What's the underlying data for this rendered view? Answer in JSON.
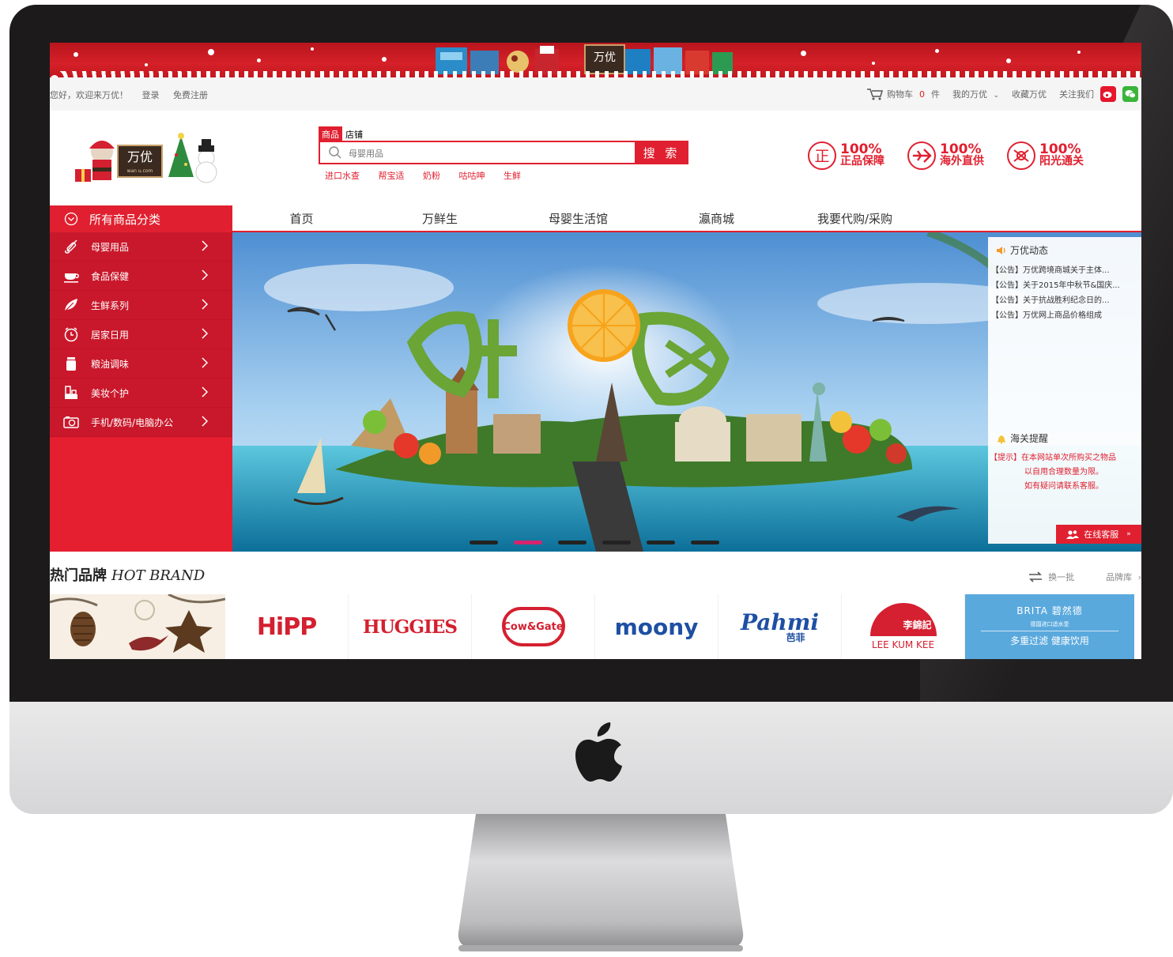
{
  "topbar": {
    "greeting": "您好，欢迎来万优！",
    "login": "登录",
    "register": "免费注册",
    "cart_label": "购物车",
    "cart_count": "0",
    "cart_unit": "件",
    "my_account": "我的万优",
    "favorite": "收藏万优",
    "follow": "关注我们"
  },
  "banner_logo": "万优",
  "logo": {
    "text": "万优",
    "sub": "wan u.com"
  },
  "search": {
    "tabs": [
      "商品",
      "店铺"
    ],
    "placeholder": "母婴用品",
    "button": "搜 索",
    "hotwords": [
      "进口水查",
      "帮宝适",
      "奶粉",
      "咕咕呻",
      "生鲜"
    ]
  },
  "guarantees": [
    {
      "pct": "100%",
      "label": "正品保障",
      "icon": "genuine-icon"
    },
    {
      "pct": "100%",
      "label": "海外直供",
      "icon": "plane-icon"
    },
    {
      "pct": "100%",
      "label": "阳光通关",
      "icon": "customs-icon"
    }
  ],
  "nav": {
    "all_categories": "所有商品分类",
    "items": [
      "首页",
      "万鲜生",
      "母婴生活馆",
      "瀛商城",
      "我要代购/采购"
    ]
  },
  "categories": [
    {
      "label": "母婴用品",
      "icon": "baby-bottle-icon"
    },
    {
      "label": "食品保健",
      "icon": "cup-icon"
    },
    {
      "label": "生鲜系列",
      "icon": "leaf-icon"
    },
    {
      "label": "居家日用",
      "icon": "clock-icon"
    },
    {
      "label": "粮油调味",
      "icon": "jar-icon"
    },
    {
      "label": "美妆个护",
      "icon": "cosmetics-icon"
    },
    {
      "label": "手机/数码/电脑办公",
      "icon": "camera-icon"
    }
  ],
  "news": {
    "title": "万优动态",
    "items": [
      "【公告】万优跨境商城关于主体...",
      "【公告】关于2015年中秋节&国庆...",
      "【公告】关于抗战胜利纪念日的...",
      "【公告】万优网上商品价格组成"
    ]
  },
  "customs": {
    "title": "海关提醒",
    "line1": "【提示】在本网站单次所购买之物品",
    "line2": "以自用合理数量为限。",
    "line3": "如有疑问请联系客服。"
  },
  "service_button": "在线客服",
  "service_arrow": "»",
  "slider": {
    "count": 6,
    "active": 1
  },
  "brands": {
    "title": "热门品牌",
    "title_en": "HOT BRAND",
    "refresh": "换一批",
    "library": "品牌库",
    "library_arrow": "›",
    "logos": [
      {
        "name": "HiPP",
        "color": "#d42030"
      },
      {
        "name": "HUGGIES",
        "color": "#d42030"
      },
      {
        "name": "Cow&Gate",
        "color": "#d42030"
      },
      {
        "name": "moony",
        "color": "#1e4fa3"
      },
      {
        "name": "Pahmi",
        "color": "#1e4fa3",
        "cn": "芭菲"
      },
      {
        "name": "LEE KUM KEE",
        "color": "#d42030",
        "cn": "李錦記"
      }
    ],
    "brita": {
      "name": "BRITA 碧然德",
      "sub": "德国进口滤水壶",
      "slogan": "多重过滤 健康饮用"
    }
  },
  "colors": {
    "accent": "#e02030",
    "bezel": "#1d1a1b",
    "chin": "#e0e0e2"
  }
}
